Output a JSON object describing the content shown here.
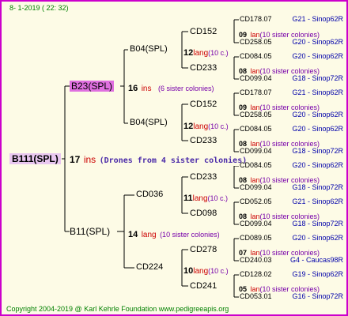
{
  "header": {
    "date": "8-  1-2019 ( 22: 32)"
  },
  "footer": {
    "copyright": "Copyright 2004-2019 @ Karl Kehrle Foundation   www.pedigreeapis.org"
  },
  "root": {
    "label": "B111(SPL)",
    "num": "17",
    "lang": "ins",
    "colonies": "(Drones from 4 sister colonies)"
  },
  "level1": [
    {
      "label": "B23(SPL)",
      "num": "16",
      "lang": "ins",
      "colonies": "(6 sister colonies)"
    },
    {
      "label": "B11(SPL)",
      "num": "14",
      "lang": "lang",
      "colonies": "(10 sister colonies)"
    }
  ],
  "level2": [
    {
      "label": "B04(SPL)",
      "num": "12",
      "lang": "lang",
      "colonies": "(10 c.)"
    },
    {
      "label": "B04(SPL)",
      "num": "12",
      "lang": "lang",
      "colonies": "(10 c.)"
    },
    {
      "label": "CD036",
      "num": "11",
      "lang": "lang",
      "colonies": "(10 c.)"
    },
    {
      "label": "CD224",
      "num": "10",
      "lang": "lang",
      "colonies": "(10 c.)"
    }
  ],
  "level3": [
    {
      "label": "CD152",
      "num": "09",
      "lang": "lan",
      "colonies": "(10 sister colonies)"
    },
    {
      "label": "CD233",
      "num": "08",
      "lang": "lan",
      "colonies": "(10 sister colonies)"
    },
    {
      "label": "CD152",
      "num": "09",
      "lang": "lan",
      "colonies": "(10 sister colonies)"
    },
    {
      "label": "CD233",
      "num": "08",
      "lang": "lan",
      "colonies": "(10 sister colonies)"
    },
    {
      "label": "CD233",
      "num": "08",
      "lang": "lan",
      "colonies": "(10 sister colonies)"
    },
    {
      "label": "CD098",
      "num": "08",
      "lang": "lan",
      "colonies": "(10 sister colonies)"
    },
    {
      "label": "CD278",
      "num": "07",
      "lang": "lan",
      "colonies": "(10 sister colonies)"
    },
    {
      "label": "CD241",
      "num": "05",
      "lang": "lan",
      "colonies": "(10 sister colonies)"
    }
  ],
  "level4": [
    {
      "label": "CD178.07",
      "code": "G21 - Sinop62R"
    },
    {
      "label": "CD258.05",
      "code": "G20 - Sinop62R"
    },
    {
      "label": "CD084.05",
      "code": "G20 - Sinop62R"
    },
    {
      "label": "CD099.04",
      "code": "G18 - Sinop72R"
    },
    {
      "label": "CD178.07",
      "code": "G21 - Sinop62R"
    },
    {
      "label": "CD258.05",
      "code": "G20 - Sinop62R"
    },
    {
      "label": "CD084.05",
      "code": "G20 - Sinop62R"
    },
    {
      "label": "CD099.04",
      "code": "G18 - Sinop72R"
    },
    {
      "label": "CD084.05",
      "code": "G20 - Sinop62R"
    },
    {
      "label": "CD099.04",
      "code": "G18 - Sinop72R"
    },
    {
      "label": "CD052.05",
      "code": "G21 - Sinop62R"
    },
    {
      "label": "CD099.04",
      "code": "G18 - Sinop72R"
    },
    {
      "label": "CD089.05",
      "code": "G20 - Sinop62R"
    },
    {
      "label": "CD240.03",
      "code": "G4 - Caucas98R"
    },
    {
      "label": "CD128.02",
      "code": "G19 - Sinop62R"
    },
    {
      "label": "CD053.01",
      "code": "G16 - Sinop72R"
    }
  ]
}
